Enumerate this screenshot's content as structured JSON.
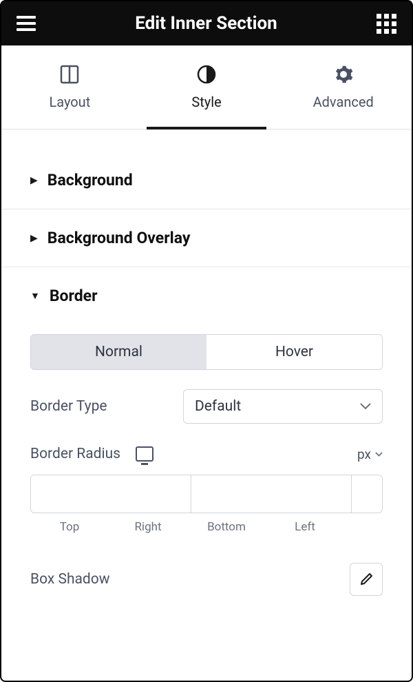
{
  "header": {
    "title": "Edit Inner Section"
  },
  "tabs": {
    "layout": "Layout",
    "style": "Style",
    "advanced": "Advanced"
  },
  "sections": {
    "background": "Background",
    "background_overlay": "Background Overlay",
    "border": "Border"
  },
  "border": {
    "toggle": {
      "normal": "Normal",
      "hover": "Hover"
    },
    "type": {
      "label": "Border Type",
      "value": "Default"
    },
    "radius": {
      "label": "Border Radius",
      "unit": "px",
      "fields": {
        "top": "Top",
        "right": "Right",
        "bottom": "Bottom",
        "left": "Left"
      }
    },
    "shadow": {
      "label": "Box Shadow"
    }
  }
}
